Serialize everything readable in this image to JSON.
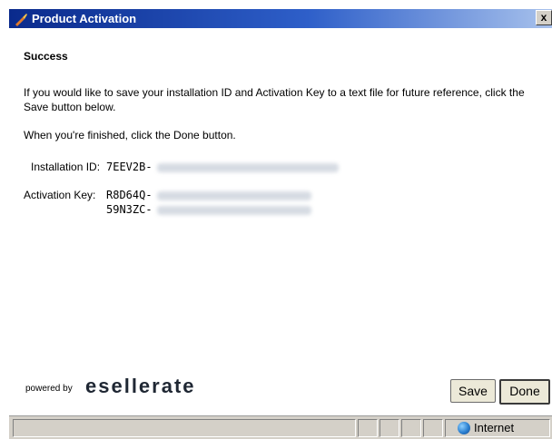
{
  "window": {
    "title": "Product Activation",
    "close_glyph": "x",
    "title_icon": "activation-icon"
  },
  "content": {
    "heading": "Success",
    "paragraph1": "If you would like to save your installation ID and Activation Key to a text file for future reference, click the Save button below.",
    "paragraph2": "When you're finished, click the Done button.",
    "installation_id_label": "Installation ID:",
    "installation_id_prefix": "7EEV2B-",
    "activation_key_label": "Activation Key:",
    "activation_key_line1_prefix": "R8D64Q-",
    "activation_key_line2_prefix": "59N3ZC-"
  },
  "footer": {
    "powered_by": "powered by",
    "brand": "esellerate",
    "save_label": "Save",
    "done_label": "Done"
  },
  "statusbar": {
    "zone_text": "Internet",
    "zone_icon": "globe-icon"
  }
}
